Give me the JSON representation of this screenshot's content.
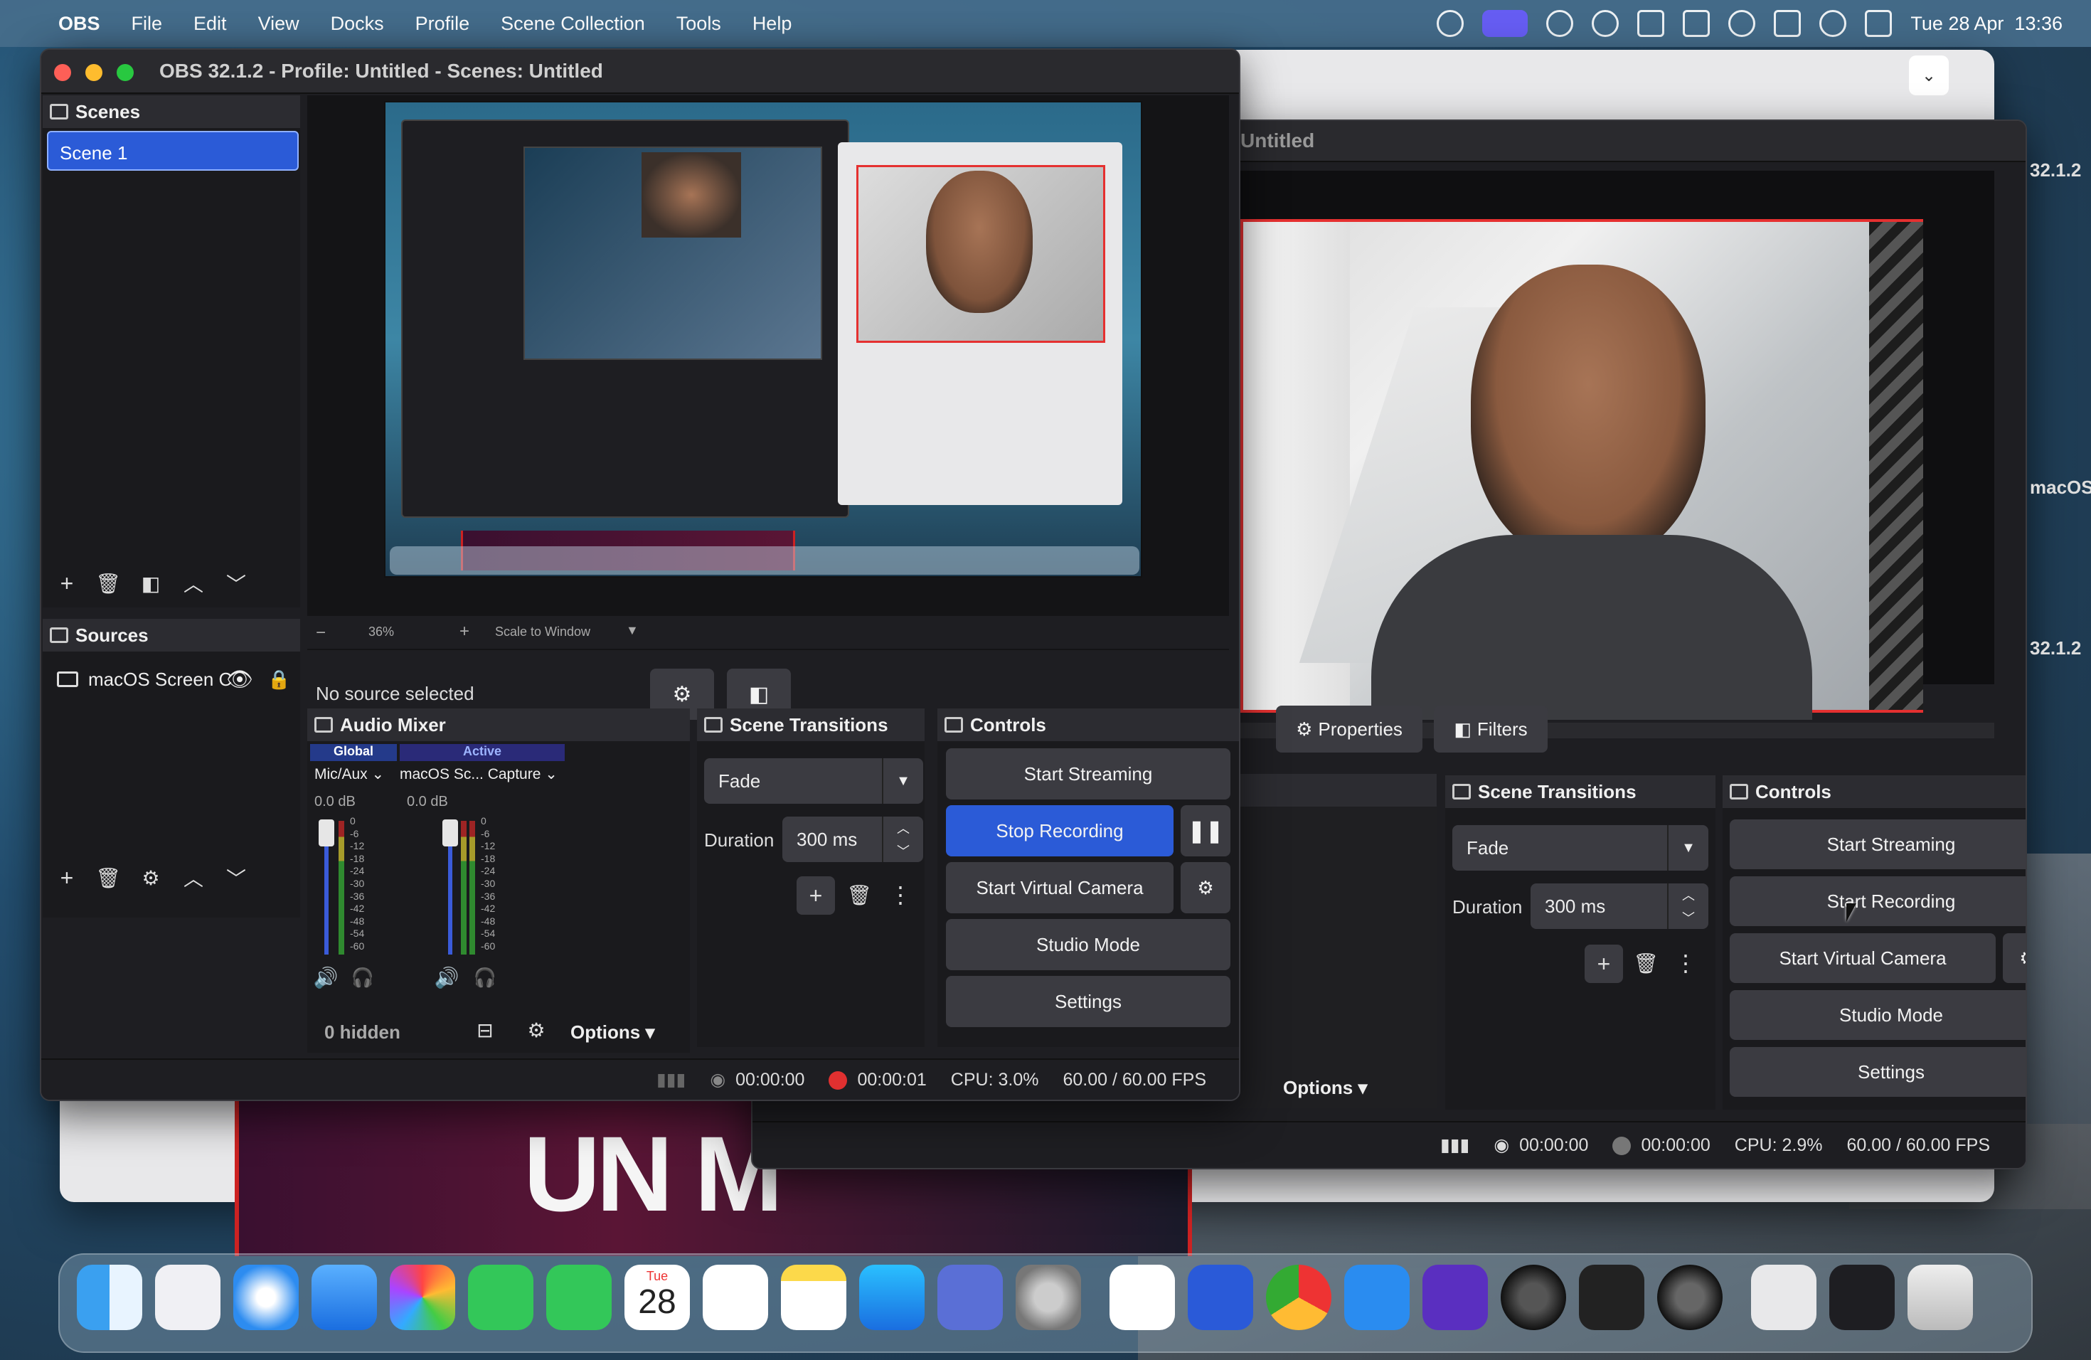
{
  "menubar": {
    "app": "OBS",
    "items": [
      "File",
      "Edit",
      "View",
      "Docks",
      "Profile",
      "Scene Collection",
      "Tools",
      "Help"
    ],
    "clock": "Tue 28 Apr  13:36"
  },
  "front": {
    "title": "OBS 32.1.2 - Profile: Untitled - Scenes: Untitled",
    "scenes_label": "Scenes",
    "scene_items": [
      "Scene 1"
    ],
    "sources_label": "Sources",
    "source_items": [
      "macOS Screen C"
    ],
    "zoom": "36%",
    "scale_mode": "Scale to Window",
    "no_source": "No source selected",
    "audio_mixer_label": "Audio Mixer",
    "mixer_tabs": [
      "Global",
      "Active"
    ],
    "channels": [
      {
        "name": "Mic/Aux",
        "db": "0.0 dB"
      },
      {
        "name": "macOS Sc... Capture",
        "db": "0.0 dB"
      }
    ],
    "meter_ticks": [
      "0",
      "-6",
      "-12",
      "-18",
      "-24",
      "-30",
      "-36",
      "-42",
      "-48",
      "-54",
      "-60"
    ],
    "hidden_count": "0 hidden",
    "options_label": "Options",
    "transitions_label": "Scene Transitions",
    "transition": "Fade",
    "duration_label": "Duration",
    "duration": "300 ms",
    "controls_label": "Controls",
    "start_streaming": "Start Streaming",
    "stop_recording": "Stop Recording",
    "start_virtual_camera": "Start Virtual Camera",
    "studio_mode": "Studio Mode",
    "settings": "Settings",
    "status": {
      "stream_time": "00:00:00",
      "rec_time": "00:00:01",
      "cpu": "CPU: 3.0%",
      "fps": "60.00 / 60.00 FPS"
    }
  },
  "back": {
    "title": "Untitled",
    "properties": "Properties",
    "filters": "Filters",
    "options_label": "Options",
    "transitions_label": "Scene Transitions",
    "transition": "Fade",
    "duration_label": "Duration",
    "duration": "300 ms",
    "controls_label": "Controls",
    "start_streaming": "Start Streaming",
    "start_recording": "Start Recording",
    "start_virtual_camera": "Start Virtual Camera",
    "studio_mode": "Studio Mode",
    "settings": "Settings",
    "side_version_1": "32.1.2",
    "side_version_2": "32.1.2",
    "side_macos": "macOS",
    "status": {
      "stream_time": "00:00:00",
      "rec_time": "00:00:00",
      "cpu": "CPU: 2.9%",
      "fps": "60.00 / 60.00 FPS"
    }
  },
  "dock": {
    "calendar_month": "Tue",
    "calendar_day": "28"
  },
  "colors": {
    "accent_blue": "#2b5bd7",
    "record_red": "#e03030",
    "panel_bg": "#1e1e22"
  }
}
